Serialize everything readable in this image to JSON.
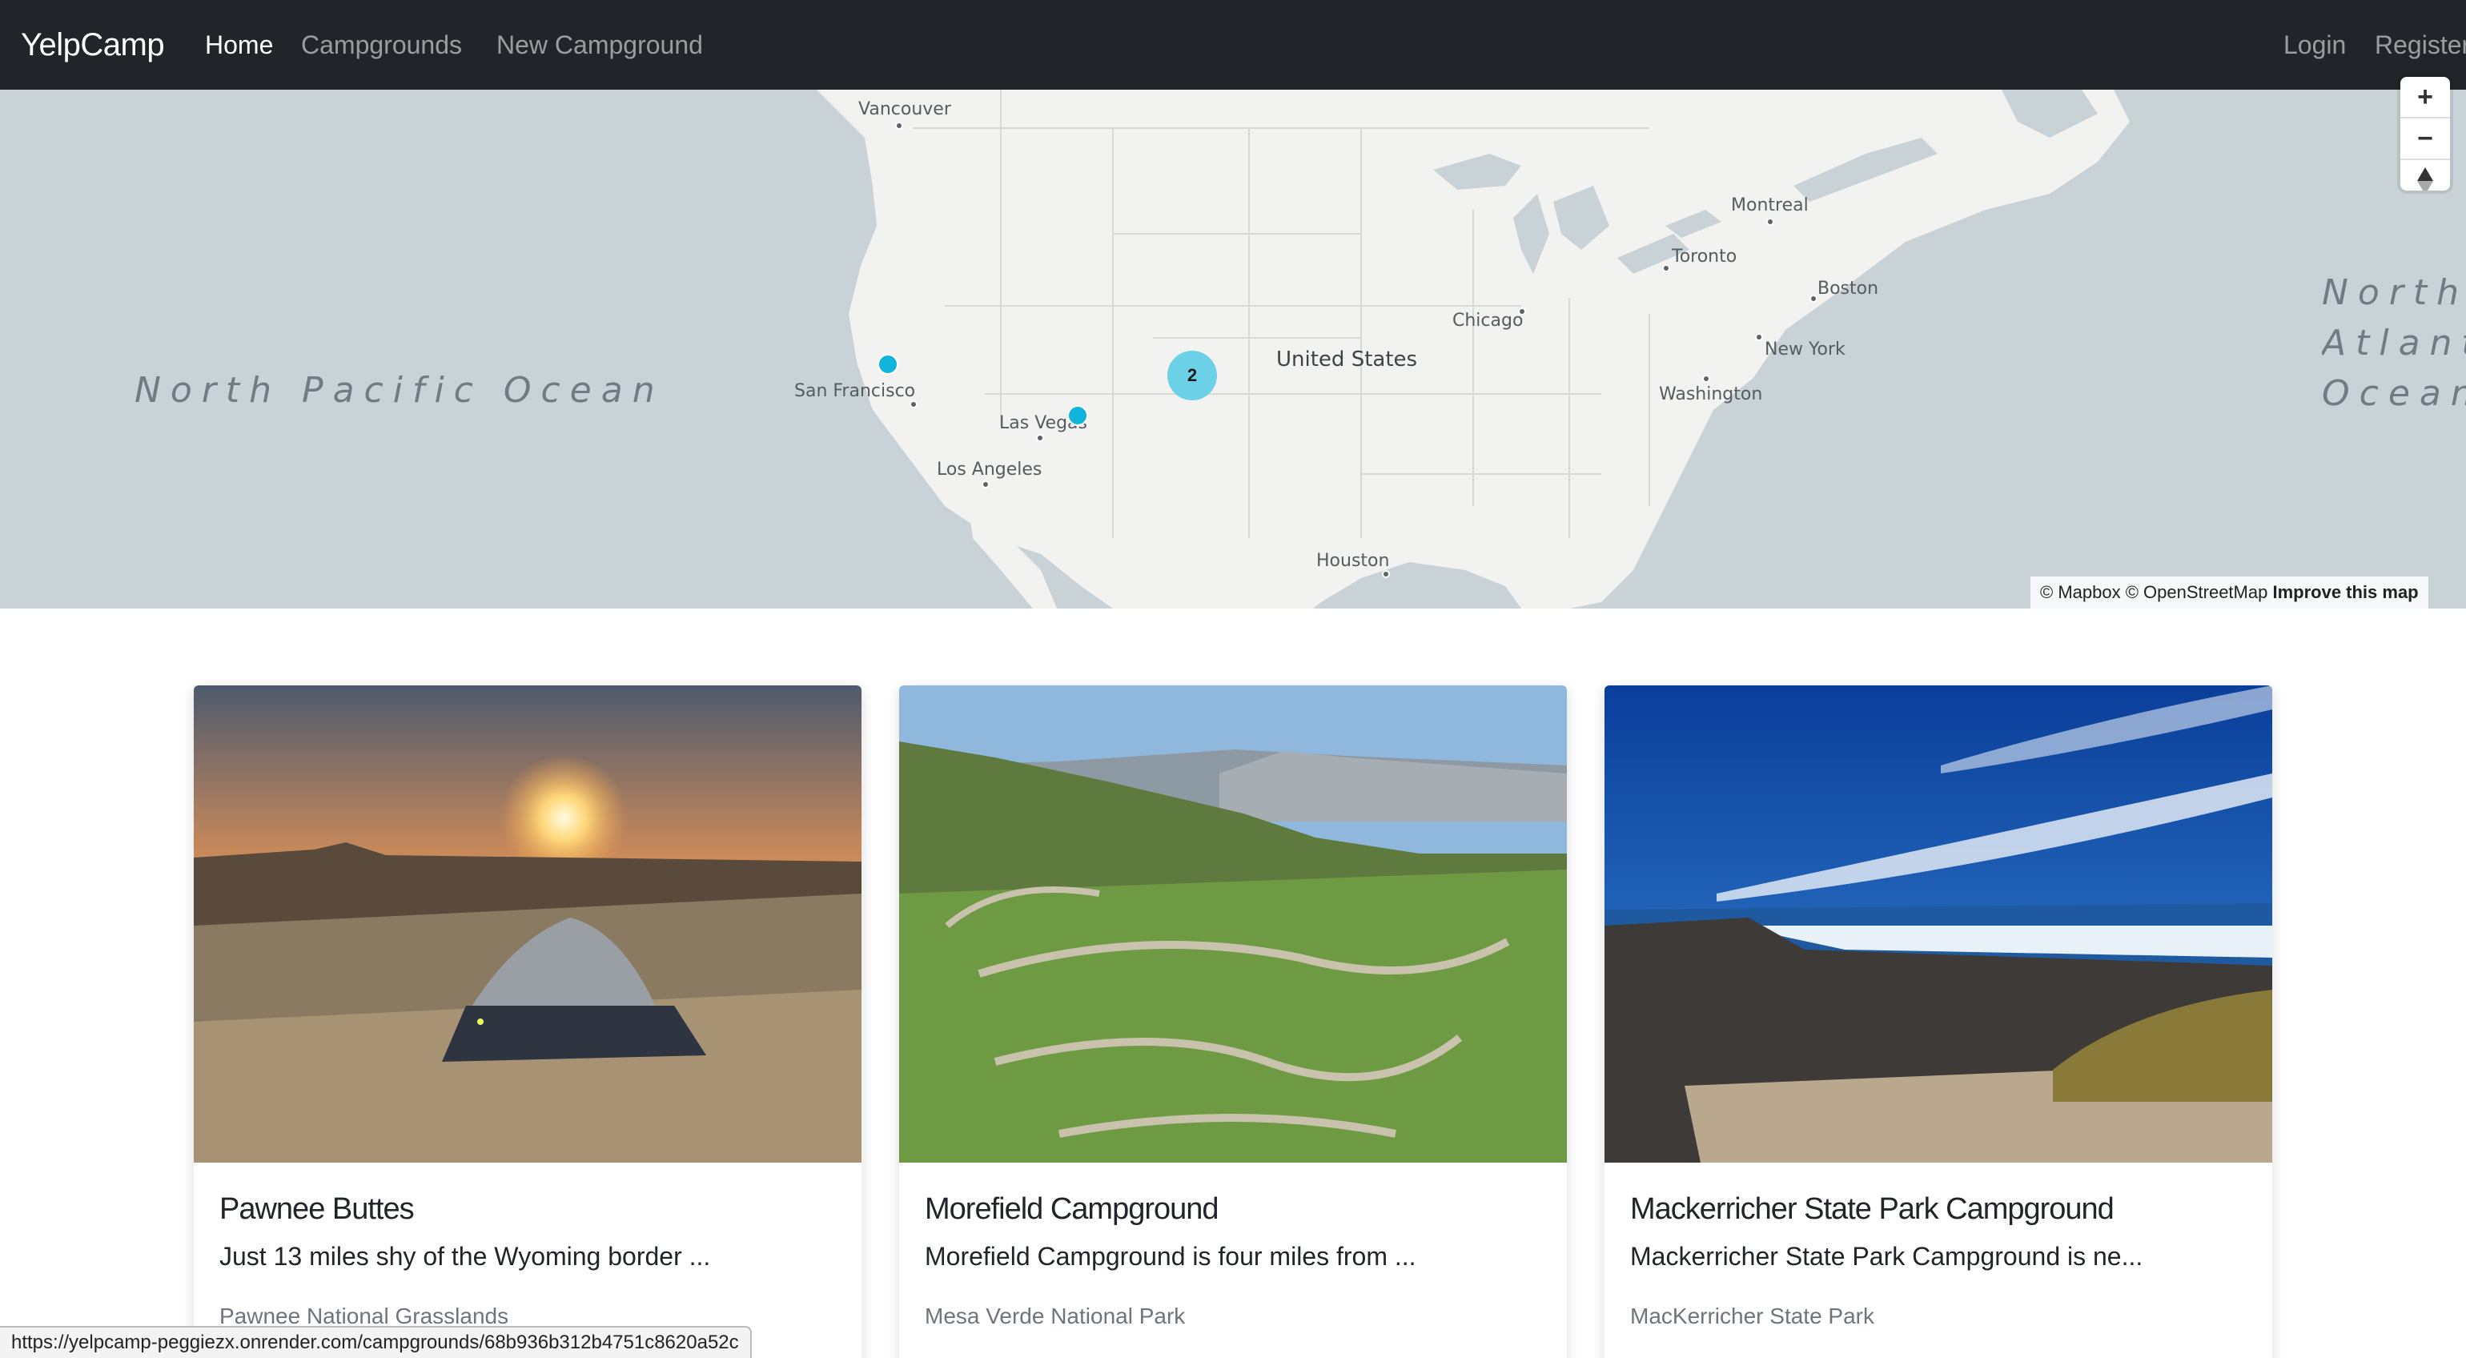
{
  "navbar": {
    "brand": "YelpCamp",
    "links": [
      "Home",
      "Campgrounds",
      "New Campground"
    ],
    "auth": [
      "Login",
      "Register"
    ]
  },
  "map": {
    "cities": [
      "Vancouver",
      "Montreal",
      "Toronto",
      "Boston",
      "Chicago",
      "New York",
      "Washington",
      "San Francisco",
      "Las Vegas",
      "Los Angeles",
      "Houston"
    ],
    "country": "United States",
    "oceans": [
      "North Pacific Ocean",
      "North Atlantic Ocean"
    ],
    "cluster_count": "2",
    "controls": [
      "zoom-in",
      "zoom-out",
      "compass"
    ],
    "logo": "mapbox",
    "attribution": "© Mapbox © OpenStreetMap",
    "improve": "Improve this map",
    "colors": {
      "land": "#f2f3f0",
      "water": "#c9d2d6",
      "marker": "#11b4da",
      "cluster": "#6cd0e6"
    }
  },
  "campgrounds": [
    {
      "title": "Pawnee Buttes",
      "description": "Just 13 miles shy of the Wyoming border ...",
      "location": "Pawnee National Grasslands"
    },
    {
      "title": "Morefield Campground",
      "description": "Morefield Campground is four miles from ...",
      "location": "Mesa Verde National Park"
    },
    {
      "title": "Mackerricher State Park Campground",
      "description": "Mackerricher State Park Campground is ne...",
      "location": "MacKerricher State Park"
    }
  ],
  "status_url": "https://yelpcamp-peggiezx.onrender.com/campgrounds/68b936b312b4751c8620a52c"
}
